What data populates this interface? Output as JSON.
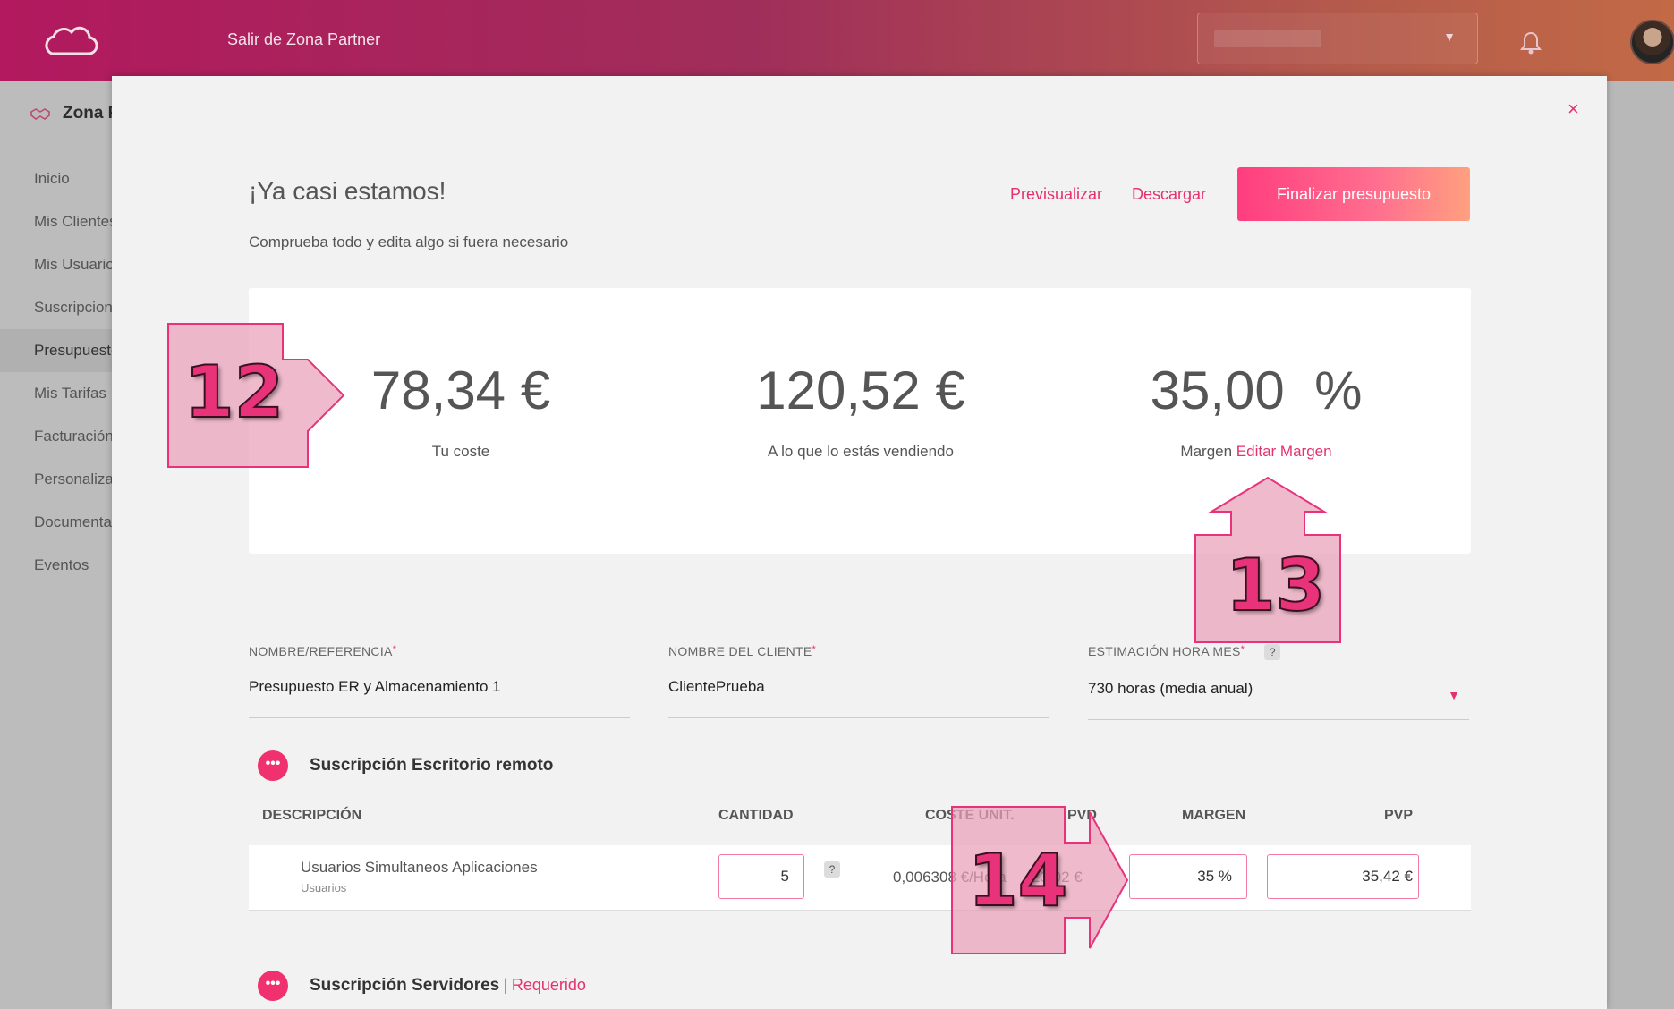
{
  "topbar": {
    "exit_link": "Salir de Zona Partner"
  },
  "sidebar": {
    "section": "Zona P",
    "items": [
      {
        "label": "Inicio"
      },
      {
        "label": "Mis Clientes"
      },
      {
        "label": "Mis Usuarios"
      },
      {
        "label": "Suscripciones"
      },
      {
        "label": "Presupuestos"
      },
      {
        "label": "Mis Tarifas"
      },
      {
        "label": "Facturación"
      },
      {
        "label": "Personaliza"
      },
      {
        "label": "Documenta"
      },
      {
        "label": "Eventos"
      }
    ]
  },
  "modal": {
    "close": "×",
    "title": "¡Ya casi estamos!",
    "subtitle": "Comprueba todo y edita algo si fuera necesario",
    "preview": "Previsualizar",
    "download": "Descargar",
    "finalize": "Finalizar presupuesto"
  },
  "summary": {
    "cost_value": "78,34 €",
    "cost_label": "Tu coste",
    "sale_value": "120,52 €",
    "sale_label": "A lo que lo estás vendiendo",
    "margin_value": "35,00  %",
    "margin_label": "Margen",
    "margin_edit": "Editar Margen"
  },
  "form": {
    "name_label": "NOMBRE/REFERENCIA",
    "name_value": "Presupuesto ER y Almacenamiento 1",
    "client_label": "NOMBRE DEL CLIENTE",
    "client_value": "ClientePrueba",
    "hours_label": "ESTIMACIÓN HORA MES",
    "hours_value": "730 horas (media anual)",
    "required_mark": "*",
    "help_mark": "?"
  },
  "sections": [
    {
      "title": "Suscripción Escritorio remoto",
      "suffix": ""
    },
    {
      "title": "Suscripción Servidores",
      "separator": "|",
      "suffix": "Requerido"
    }
  ],
  "table": {
    "headers": {
      "description": "DESCRIPCIÓN",
      "quantity": "CANTIDAD",
      "unit_cost": "COSTE UNIT.",
      "pvd": "PVD",
      "margin": "MARGEN",
      "pvp": "PVP"
    },
    "rows": [
      {
        "description": "Usuarios Simultaneos Aplicaciones",
        "sub": "Usuarios",
        "quantity": "5",
        "unit_cost": "0,006308 €/Hora",
        "pvd": "23,02 €",
        "margin": "35 %",
        "pvp": "35,42 €"
      }
    ]
  },
  "annotations": [
    "12",
    "13",
    "14"
  ],
  "colors": {
    "accent": "#e5316e",
    "annotation_fill": "#e8a0b8"
  }
}
